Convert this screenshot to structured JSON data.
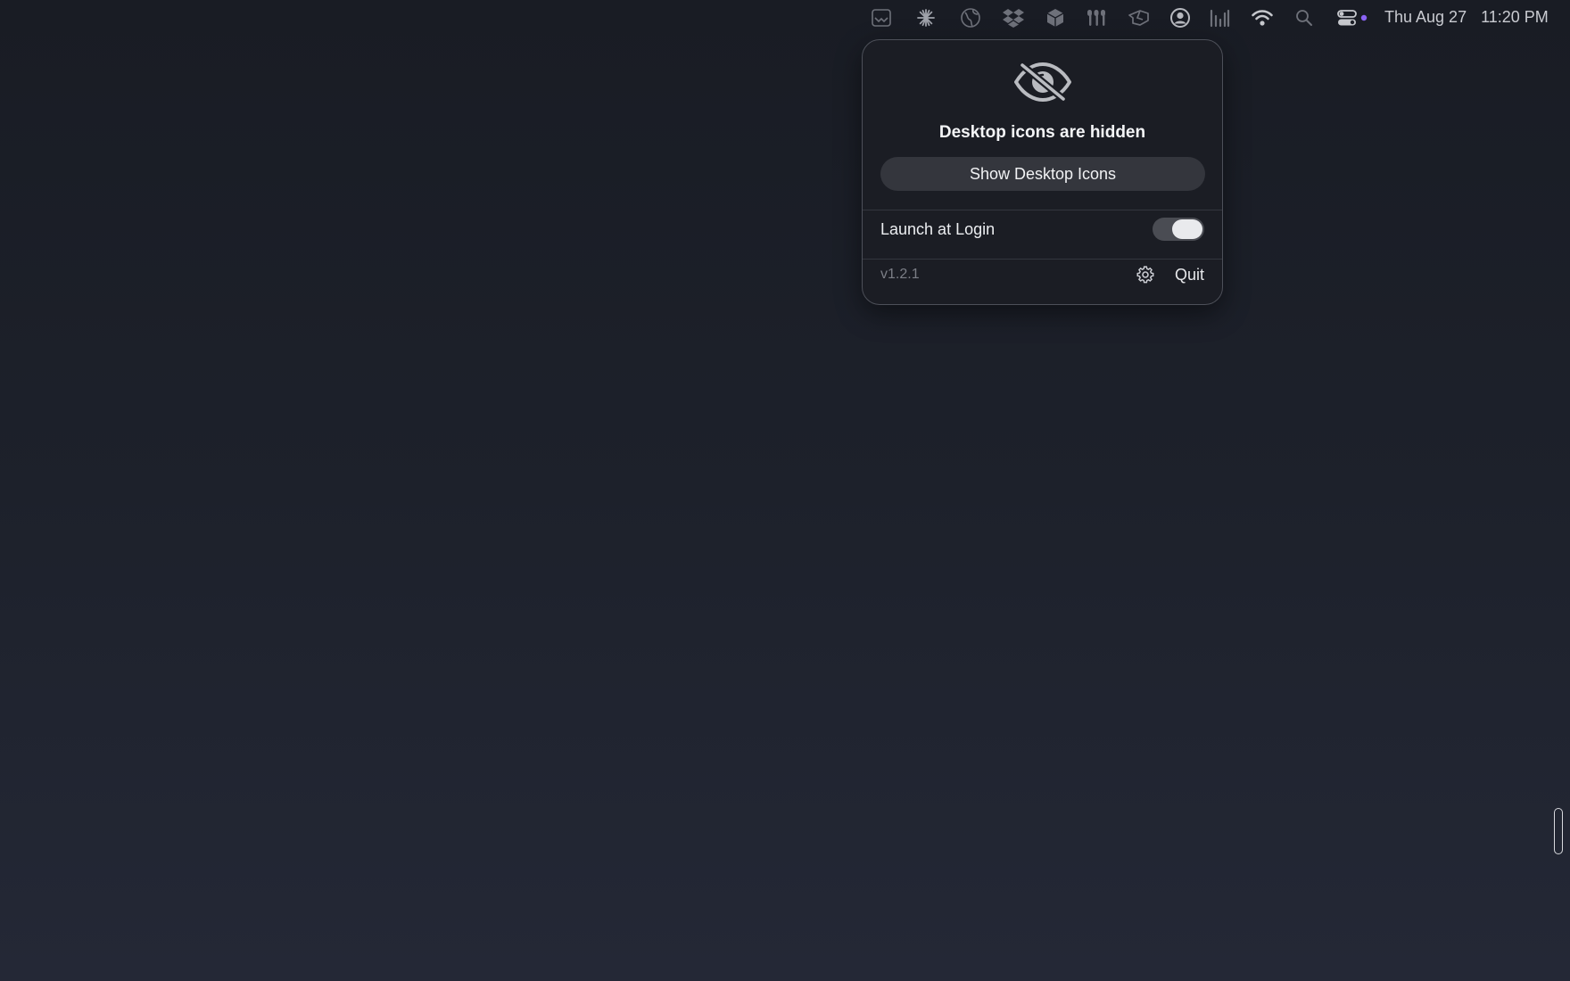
{
  "menubar": {
    "status_icons": [
      "mail-tray-icon",
      "sparkle-icon",
      "globe-icon",
      "dropbox-icon",
      "cube-icon",
      "airpods-icon",
      "hand-icon",
      "user-account-icon",
      "audio-levels-icon",
      "wifi-icon",
      "spotlight-search-icon",
      "control-center-icon"
    ],
    "date": "Thu Aug 27",
    "time": "11:20 PM",
    "accent_dot_color": "#8a63f5"
  },
  "popover": {
    "status_icon": "eye-slash-icon",
    "title": "Desktop icons are hidden",
    "show_button_label": "Show Desktop Icons",
    "launch_at_login": {
      "label": "Launch at Login",
      "enabled": true
    },
    "version": "v1.2.1",
    "settings_icon": "gear-icon",
    "quit_label": "Quit"
  },
  "colors": {
    "desktop_top": "#191c24",
    "desktop_bottom": "#242836",
    "popover_bg": "#1b1d24",
    "button_bg": "#34363d",
    "toggle_track": "#4a4c53",
    "toggle_knob": "#e9eaed"
  }
}
